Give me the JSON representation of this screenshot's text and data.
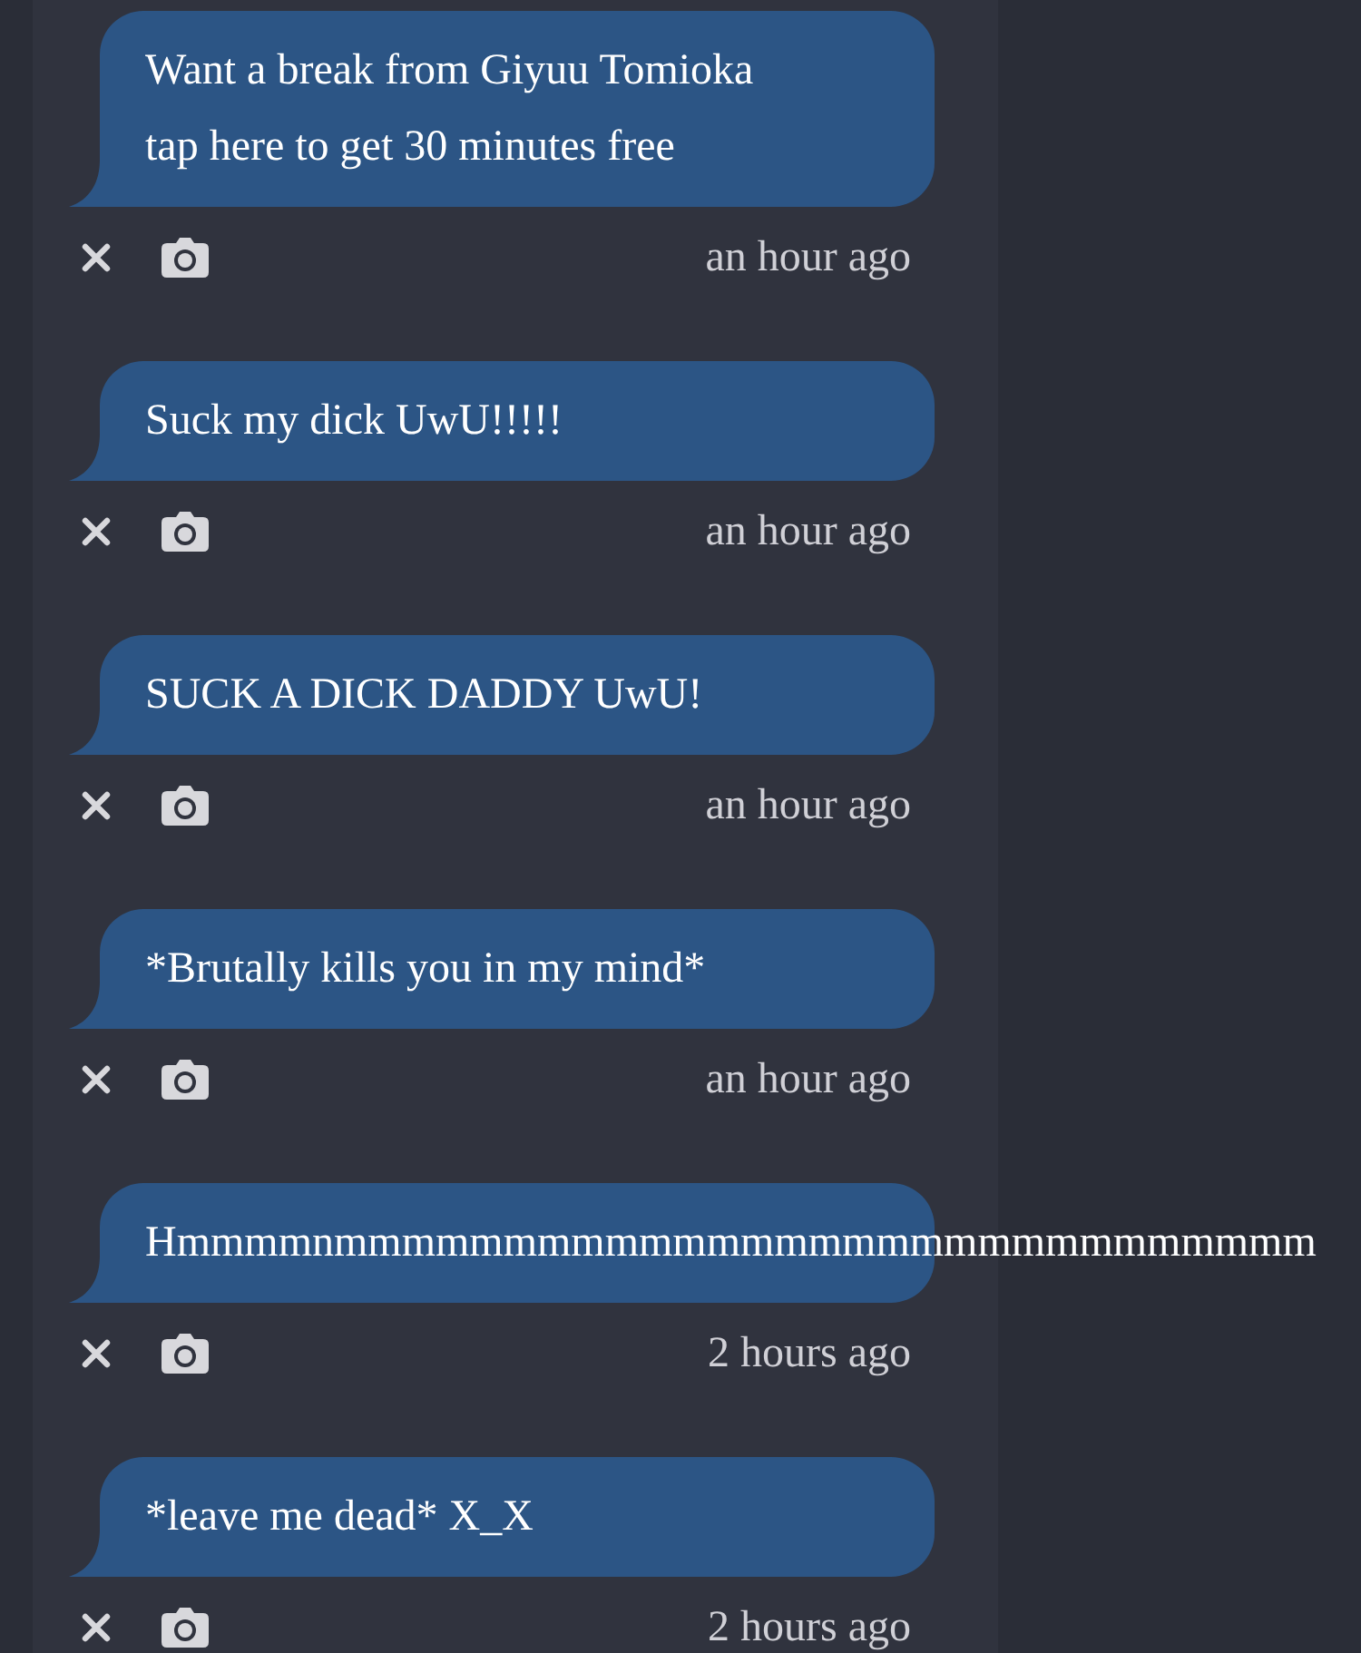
{
  "messages": [
    {
      "text": "Want a break from Giyuu Tomioka tap here to get 30 minutes free",
      "time": "an hour ago"
    },
    {
      "text": "Suck my dick UwU!!!!!",
      "time": "an hour ago"
    },
    {
      "text": "SUCK A DICK DADDY UwU!",
      "time": "an hour ago"
    },
    {
      "text": "*Brutally kills you in my mind*",
      "time": "an hour ago"
    },
    {
      "text": "Hmmmmnmmmmmmmmmmmmmmmmmmmmmmmmmmmmm",
      "time": "2 hours ago"
    },
    {
      "text": "*leave me dead* X_X",
      "time": "2 hours ago"
    }
  ]
}
